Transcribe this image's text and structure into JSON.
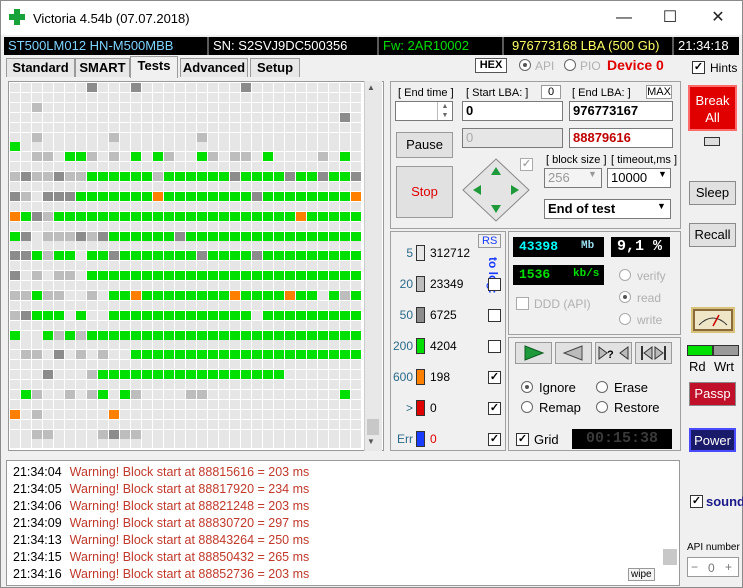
{
  "window": {
    "title": "Victoria 4.54b (07.07.2018)",
    "minimize": "—",
    "maximize": "☐",
    "close": "✕"
  },
  "status_strip": {
    "model": "ST500LM012 HN-M500MBB",
    "serial": "SN: S2SVJ9DC500356",
    "firmware": "Fw: 2AR10002",
    "capacity": "976773168 LBA (500 Gb)",
    "clock": "21:34:18",
    "colors": {
      "model": "#7fd4ff",
      "serial": "#ffffff",
      "firmware": "#00e000",
      "capacity": "#ffff66",
      "clock": "#ffffff"
    }
  },
  "tabs": [
    {
      "label": "Standard",
      "active": false
    },
    {
      "label": "SMART",
      "active": false
    },
    {
      "label": "Tests",
      "active": true
    },
    {
      "label": "Advanced",
      "active": false
    },
    {
      "label": "Setup",
      "active": false
    }
  ],
  "top_controls": {
    "hex": "HEX",
    "api": "API",
    "pio": "PIO",
    "device": "Device 0",
    "hints": "Hints",
    "hints_checked": "✓"
  },
  "scan_panel": {
    "end_time_label": "[ End time ]",
    "start_lba_label": "[ Start LBA: ]",
    "start_lba_counter": "0",
    "end_lba_label": "[ End LBA: ]",
    "max_label": "MAX",
    "start_lba_value": "0",
    "end_lba_value": "976773167",
    "current_lba_disabled": "0",
    "current_lba_red": "88879616",
    "pause": "Pause",
    "stop": "Stop",
    "block_size_label": "[ block size ]",
    "block_size_value": "256",
    "timeout_label": "[ timeout,ms ]",
    "timeout_value": "10000",
    "end_action": "End of test"
  },
  "legend": {
    "rs": "RS",
    "to_log": "to log:",
    "rows": [
      {
        "threshold": "5",
        "count": "312712",
        "color": "#e6e6e6",
        "checked": ""
      },
      {
        "threshold": "20",
        "count": "23349",
        "color": "#bdbdbd",
        "checked": ""
      },
      {
        "threshold": "50",
        "count": "6725",
        "color": "#8c8c8c",
        "checked": ""
      },
      {
        "threshold": "200",
        "count": "4204",
        "color": "#00e000",
        "checked": ""
      },
      {
        "threshold": "600",
        "count": "198",
        "color": "#ff8000",
        "checked": "✓"
      },
      {
        "threshold": ">",
        "count": "0",
        "color": "#e00000",
        "checked": "✓"
      },
      {
        "threshold": "Err",
        "count": "0",
        "color": "#1a3cff",
        "checked": "✓"
      }
    ]
  },
  "stats": {
    "mb_value": "43398",
    "mb_unit": "Mb",
    "percent_value": "9,1",
    "percent_unit": "%",
    "speed_value": "1536",
    "speed_unit": "kb/s",
    "ddd_api": "DDD (API)",
    "verify": "verify",
    "read": "read",
    "write": "write",
    "ignore": "Ignore",
    "erase": "Erase",
    "remap": "Remap",
    "restore": "Restore",
    "grid": "Grid",
    "grid_checked": "✓",
    "timer": "00:15:38"
  },
  "right_column": {
    "break_all": "Break All",
    "sleep": "Sleep",
    "recall": "Recall",
    "rd": "Rd",
    "wrt": "Wrt",
    "passp": "Passp",
    "power": "Power",
    "sound": "sound",
    "sound_checked": "✓",
    "api_number": "API number",
    "api_value": "0"
  },
  "log": {
    "wipe": "wipe",
    "lines": [
      {
        "time": "21:34:04",
        "msg": "Warning! Block start at 88815616 = 203 ms"
      },
      {
        "time": "21:34:05",
        "msg": "Warning! Block start at 88817920 = 234 ms"
      },
      {
        "time": "21:34:06",
        "msg": "Warning! Block start at 88821248 = 203 ms"
      },
      {
        "time": "21:34:09",
        "msg": "Warning! Block start at 88830720 = 297 ms"
      },
      {
        "time": "21:34:13",
        "msg": "Warning! Block start at 88843264 = 250 ms"
      },
      {
        "time": "21:34:15",
        "msg": "Warning! Block start at 88850432 = 265 ms"
      },
      {
        "time": "21:34:16",
        "msg": "Warning! Block start at 88852736 = 203 ms"
      }
    ]
  },
  "block_map": {
    "columns": 32,
    "rows": 37,
    "palette": {
      "W": "#ffffff",
      "L": "#e6e6e6",
      "M": "#bdbdbd",
      "D": "#8c8c8c",
      "G": "#00e000",
      "O": "#ff8000"
    },
    "map": [
      "LLLLLLLDLLLDLLLLLLLLLDLLLLLLLLLL",
      "LLLLLLLLLLLLLLLLLLLLLLLLLLLLLLLL",
      "LLMLLLLLLLLLLLLLLLLLLLLLLLLLLLLL",
      "LLLLLLLLLLLLLLLLLLLLLLLLLLLLLLDL",
      "LLLLLLLLLLLLLLLLLLLLLLLLLLLLLLLL",
      "LLMLLLLLLMLLLLLLLMLLLLLLLLLLLLLL",
      "GLLLLLLLLLLLLLLLLLLLLLLLLLLLLLLL",
      "LLMMLGGMLMLGLGMLLGMLMMLGLLLLMLGL",
      "LLLLLLLLLLLLLLLLLLLLLLLLLLLLLLLL",
      "MDMMDMMGGGGGGMGGGGGGDGGGGDGGDGGD",
      "LLLLLLLLLLLLLLLLLLLLLLLLLLLLLLLL",
      "DMLDDDGGGGGGGOGGGGGGGGDGGGGGGGGO",
      "LLLLLLLLLLLLLLLLLLLLLLLLLLLLLLLL",
      "OGDMGGGGGGGGGGGGGGGGGGGGGGOGGGGG",
      "LLLLLLLLLLLLLLLLLLLLLLLLLLLLLLLL",
      "GDLMMMDMDGGGGGGDGGGGGGGGGGGGGGGG",
      "LLLLLLLLLLLLLLLLLLLLLLLLLLLLLLLL",
      "DDGMGGLGGDGGGGGGGDGGGGDGGGGGGGGG",
      "LLLLLLLLLLLLLLLLLLLLLLLLLLLLLLLL",
      "DLMLMMLGGGGGGGGGGGGGGGGGGGGGGGGG",
      "LLLLLLLLLLLLLLLLLLLLLLLLLLLLLLLL",
      "MMGMMLLMLGGOGGGGGGGGOGGGGOGGLGMG",
      "LLLLLLLLLLLLLLLLLLLLLLLLLLLLLLLL",
      "MDGGGLGLLGGGGGGGGGGGGGLGGGGGGGGG",
      "LLLLLLLLLLLLLLLLLLLLLLLLLLLLLLLL",
      "GLLGMGMGGGGGGGGGGGGGGGGGGGGGGGGG",
      "LLLLLLLLLLLLLLLLLLLLLLLLLLLLLLLL",
      "LMMLDLMLMLLGGGGGGGGGGGGGGGGGGGGG",
      "LLLLLLLLLLLLLLLLLLLLLLLLLLLLLLLL",
      "LLLDLLLMGGGGGGGGGGGGGGGGGLLLLLLL",
      "LLLLLLLLLLLLLLLLLLLLLLLLLLLLLLLL",
      "LGMLLMLMGLGMLLLLMMLLLLLLLLLLLLGL",
      "LLLLLLLLLLLLLLLLLLLLLLLLLLLLLLLL",
      "OLMLLLLLLOLLLLLLLLLLLLLLLLLLLLLL",
      "LLLLLLLLLLLLLLLLLLLLLLLLLLLLLLLL",
      "LLMMLLLLMDMMLLLLLLLLLLLLLLLLLLLL",
      "LLLLLLLLLLLLLLLLLLLLLLLLLLLLLLLL"
    ]
  }
}
